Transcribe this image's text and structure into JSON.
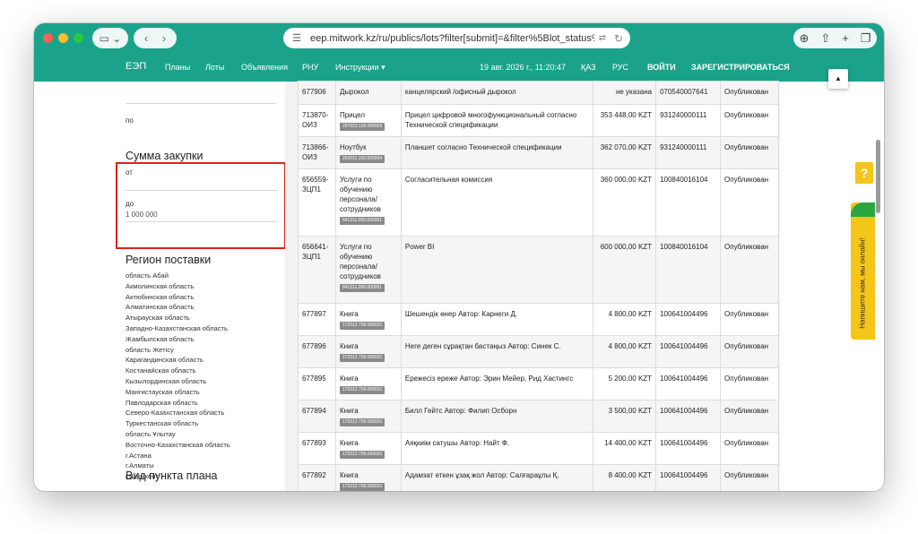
{
  "browser": {
    "url": "eep.mitwork.kz/ru/publics/lots?filter[submit]=&filter%5Blot_status%5D=EMPT"
  },
  "navbar": {
    "brand": "ЕЭП",
    "items": [
      "Планы",
      "Лоты",
      "Объявления",
      "РНУ",
      "Инструкции ▾"
    ],
    "datetime": "19 авг. 2026 г., 11:20:47",
    "lang_kaz": "ҚАЗ",
    "lang_rus": "РУС",
    "login": "ВОЙТИ",
    "register": "ЗАРЕГИСТРИРОВАТЬСЯ"
  },
  "filters": {
    "prev_to_label": "по",
    "amount_title": "Сумма закупки",
    "amount_from_label": "от",
    "amount_to_label": "до",
    "amount_to_value": "1 000 000",
    "region_title": "Регион поставки",
    "regions": [
      "область Абай",
      "Акмолинская область",
      "Актюбинская область",
      "Алматинская область",
      "Атырауская область",
      "Западно-Казахстанская область",
      "Жамбылская область",
      "область Жетісу",
      "Карагандинская область",
      "Костанайская область",
      "Кызылординская область",
      "Мангистауская область",
      "Павлодарская область",
      "Северо-Казахстанская область",
      "Туркестанская область",
      "область Ұлытау",
      "Восточно-Казахстанская область",
      "г.Астана",
      "г.Алматы",
      "г.Шымкент"
    ],
    "plan_type_title": "Вид пункта плана"
  },
  "table": {
    "rows": [
      {
        "num": "677906",
        "name": "Дырокол",
        "code": "",
        "desc": "канцелярский /офисный дырокол",
        "price": "не указана",
        "bin": "070540007641",
        "status": "Опубликован"
      },
      {
        "num": "713870-ОИЗ",
        "name": "Прицел",
        "code": "267023.100.000003",
        "desc": "Прицел цифровой многофункциональный согласно Технической спецификации",
        "price": "353 448,00 KZT",
        "bin": "931240000111",
        "status": "Опубликован"
      },
      {
        "num": "713866-ОИЗ",
        "name": "Ноутбук",
        "code": "262011.100.000004",
        "desc": "Планшет согласно Технической спецификации",
        "price": "362 070,00 KZT",
        "bin": "931240000111",
        "status": "Опубликован"
      },
      {
        "num": "656559-ЗЦП1",
        "name": "Услуги по обучению персонала/ сотрудников",
        "code": "841311.000.000001",
        "desc": "Согласительная комиссия",
        "price": "360 000,00 KZT",
        "bin": "100840016104",
        "status": "Опубликован"
      },
      {
        "num": "656641-ЗЦП1",
        "name": "Услуги по обучению персонала/ сотрудников",
        "code": "841311.000.000001",
        "desc": "Power BI",
        "price": "600 000,00 KZT",
        "bin": "100840016104",
        "status": "Опубликован"
      },
      {
        "num": "677897",
        "name": "Книга",
        "code": "172312.700.000031",
        "desc": "Шешендік өнер Автор: Карнеги Д.",
        "price": "4 800,00 KZT",
        "bin": "100641004496",
        "status": "Опубликован"
      },
      {
        "num": "677896",
        "name": "Книга",
        "code": "172312.700.000031",
        "desc": "Неге деген сұрақтан бастаңыз Автор: Синек С.",
        "price": "4 800,00 KZT",
        "bin": "100641004496",
        "status": "Опубликован"
      },
      {
        "num": "677895",
        "name": "Книга",
        "code": "172312.700.000031",
        "desc": "Ережесіз ереже Автор: Эрин Мейер, Рид Хастингс",
        "price": "5 200,00 KZT",
        "bin": "100641004496",
        "status": "Опубликован"
      },
      {
        "num": "677894",
        "name": "Книга",
        "code": "172312.700.000031",
        "desc": "Билл Гейтс Автор: Филип Осборн",
        "price": "3 500,00 KZT",
        "bin": "100641004496",
        "status": "Опубликован"
      },
      {
        "num": "677893",
        "name": "Книга",
        "code": "172312.700.000031",
        "desc": "Аяқкиім сатушы Автор: Найт Ф.",
        "price": "14 400,00 KZT",
        "bin": "100641004496",
        "status": "Опубликован"
      },
      {
        "num": "677892",
        "name": "Книга",
        "code": "172312.700.000031",
        "desc": "Адамзат еткен ұзақ жол Автор: Салғараұлы Қ.",
        "price": "8 400,00 KZT",
        "bin": "100641004496",
        "status": "Опубликован"
      }
    ]
  },
  "widgets": {
    "help_label": "?",
    "chat_label": "Напишите нам, мы онлайн!"
  }
}
